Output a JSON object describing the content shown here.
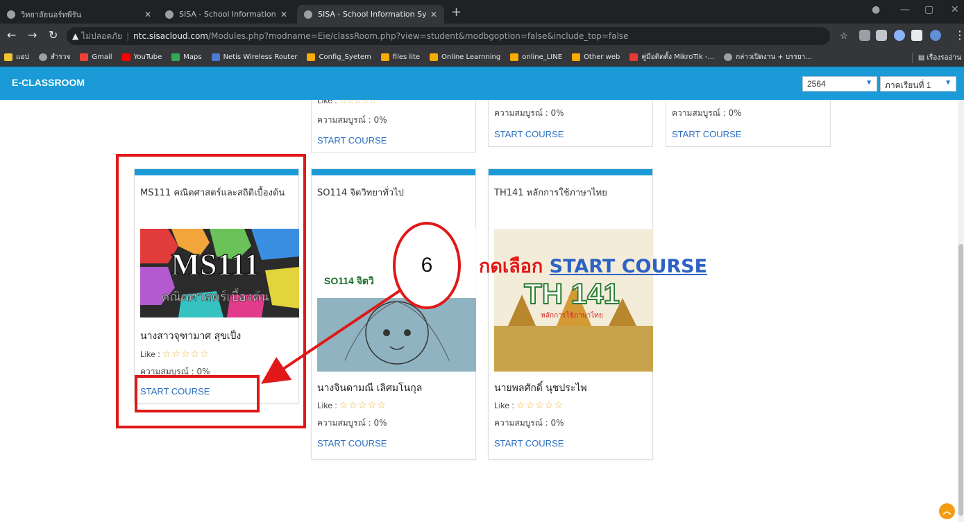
{
  "browser": {
    "tabs": [
      {
        "title": "วิทยาลัยนอร์ทพีรัน",
        "active": false
      },
      {
        "title": "SISA - School Information Systen",
        "active": false
      },
      {
        "title": "SISA - School Information Systen",
        "active": true
      }
    ],
    "address": {
      "security": "ไม่ปลอดภัย",
      "host": "ntc.sisacloud.com",
      "path": "/Modules.php?modname=Eie/classRoom.php?view=student&modbgoption=false&include_top=false"
    },
    "bookmarks": [
      "แอป",
      "สำรวจ",
      "Gmail",
      "YouTube",
      "Maps",
      "Netis Wireless Router",
      "Config_Syetem",
      "files lite",
      "Online Learnning",
      "online_LINE",
      "Other web",
      "คู่มือติดตั้ง MikroTik -...",
      "กล่าวเปิดงาน + บรรยา..."
    ],
    "reading_list": "เรื่องรออ่าน"
  },
  "app": {
    "title": "E-CLASSROOM",
    "year": "2564",
    "term": "ภาคเรียนที่ 1"
  },
  "top_cards": [
    {
      "like_label": "Like :",
      "progress": "ความสมบูรณ์ : 0%",
      "action": "START COURSE"
    },
    {
      "progress": "ความสมบูรณ์ : 0%",
      "action": "START COURSE"
    },
    {
      "progress": "ความสมบูรณ์ : 0%",
      "action": "START COURSE"
    }
  ],
  "courses": [
    {
      "title": "MS111 คณิตศาสตร์และสถิติเบื้องต้น",
      "image_text": "MS111",
      "image_subtext": "คณิตศาสตร์เบื้องต้น",
      "teacher": "นางสาวจุฑามาศ สุขเป็ง",
      "like_label": "Like :",
      "rating": 0,
      "progress": "ความสมบูรณ์ : 0%",
      "action": "START COURSE"
    },
    {
      "title": "SO114 จิตวิทยาทั่วไป",
      "image_text": "SO114 จิตวิ",
      "teacher": "นางจินดามณี เลิศมโนกุล",
      "like_label": "Like :",
      "rating": 0,
      "progress": "ความสมบูรณ์ : 0%",
      "action": "START COURSE"
    },
    {
      "title": "TH141 หลักการใช้ภาษาไทย",
      "image_text": "TH 141",
      "image_subtext": "หลักการใช้ภาษาไทย",
      "teacher": "นายพลศักดิ์ นุชประไพ",
      "like_label": "Like :",
      "rating": 0,
      "progress": "ความสมบูรณ์ : 0%",
      "action": "START COURSE"
    }
  ],
  "annotation": {
    "step": "6",
    "instruction": "กดเลือก",
    "target_link": "START COURSE",
    "color": "#e11818"
  },
  "colors": {
    "header": "#1a9ad6",
    "link": "#2a6fc0",
    "stars": "#f1b233"
  }
}
